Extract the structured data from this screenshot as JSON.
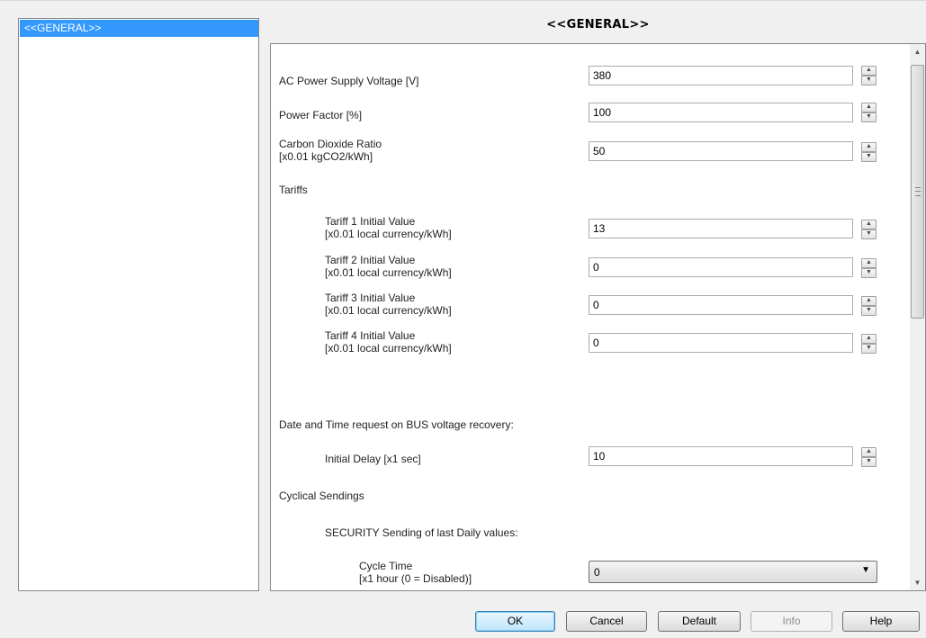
{
  "tree": {
    "items": [
      {
        "label": "<<GENERAL>>"
      }
    ]
  },
  "header": {
    "title": "<<GENERAL>>"
  },
  "parameters": {
    "ac_voltage": {
      "label": "AC Power Supply Voltage [V]",
      "value": "380"
    },
    "power_factor": {
      "label": "Power Factor [%]",
      "value": "100"
    },
    "co2_ratio": {
      "label_line1": "Carbon Dioxide Ratio",
      "label_line2": "[x0.01 kgCO2/kWh]",
      "value": "50"
    },
    "tariffs_heading": "Tariffs",
    "tariff1": {
      "label_line1": "Tariff 1 Initial Value",
      "label_line2": "[x0.01 local currency/kWh]",
      "value": "13"
    },
    "tariff2": {
      "label_line1": "Tariff 2 Initial Value",
      "label_line2": "[x0.01 local currency/kWh]",
      "value": "0"
    },
    "tariff3": {
      "label_line1": "Tariff 3 Initial Value",
      "label_line2": "[x0.01 local currency/kWh]",
      "value": "0"
    },
    "tariff4": {
      "label_line1": "Tariff 4 Initial Value",
      "label_line2": "[x0.01 local currency/kWh]",
      "value": "0"
    },
    "date_time_heading": "Date and Time request on BUS voltage recovery:",
    "initial_delay": {
      "label": "Initial Delay [x1 sec]",
      "value": "10"
    },
    "cyclical_heading": "Cyclical Sendings",
    "security_heading": "SECURITY Sending of last Daily values:",
    "cycle_time": {
      "label_line1": "Cycle Time",
      "label_line2": "[x1 hour (0 = Disabled)]",
      "value": "0"
    }
  },
  "buttons": {
    "ok": "OK",
    "cancel": "Cancel",
    "default": "Default",
    "info": "Info",
    "help": "Help"
  },
  "icons": {
    "spin_up": "spin-up-arrow-icon",
    "spin_down": "spin-down-arrow-icon",
    "dropdown": "chevron-down-icon"
  },
  "colors": {
    "selection": "#3399ff",
    "panel_border": "#828790",
    "window_bg": "#f0f0f0"
  }
}
